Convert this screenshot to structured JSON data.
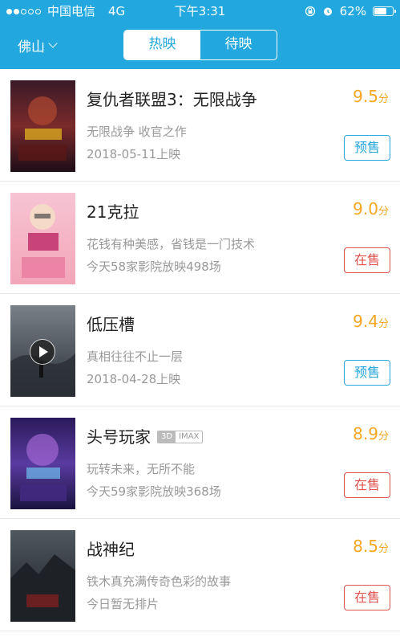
{
  "status_bar": {
    "carrier": "中国电信",
    "network": "4G",
    "time": "下午3:31",
    "battery": "62%",
    "battery_level": 0.62,
    "icons": [
      "signal-dots-icon",
      "rotation-lock-icon",
      "alarm-icon",
      "battery-icon"
    ]
  },
  "header": {
    "city": "佛山",
    "tabs": [
      {
        "label": "热映",
        "active": true
      },
      {
        "label": "待映",
        "active": false
      }
    ],
    "bg_color": "#22a8de"
  },
  "movies": [
    {
      "title": "复仇者联盟3：无限战争",
      "score": "9.5",
      "score_unit": "分",
      "desc": "无限战争 收官之作",
      "info": "2018-05-11上映",
      "button": "预售",
      "button_type": "presale"
    },
    {
      "title": "21克拉",
      "score": "9.0",
      "score_unit": "分",
      "desc": "花钱有种美感，省钱是一门技术",
      "info": "今天58家影院放映498场",
      "button": "在售",
      "button_type": "onsale"
    },
    {
      "title": "低压槽",
      "score": "9.4",
      "score_unit": "分",
      "desc": "真相往往不止一层",
      "info": "2018-04-28上映",
      "button": "预售",
      "button_type": "presale",
      "has_trailer": true
    },
    {
      "title": "头号玩家",
      "tags": [
        "3D",
        "IMAX"
      ],
      "score": "8.9",
      "score_unit": "分",
      "desc": "玩转未来，无所不能",
      "info": "今天59家影院放映368场",
      "button": "在售",
      "button_type": "onsale"
    },
    {
      "title": "战神纪",
      "score": "8.5",
      "score_unit": "分",
      "desc": "铁木真充满传奇色彩的故事",
      "info": "今日暂无排片",
      "button": "在售",
      "button_type": "onsale"
    }
  ],
  "colors": {
    "score": "#f5a623",
    "presale": "#26a6dd",
    "onsale": "#e0524c"
  }
}
